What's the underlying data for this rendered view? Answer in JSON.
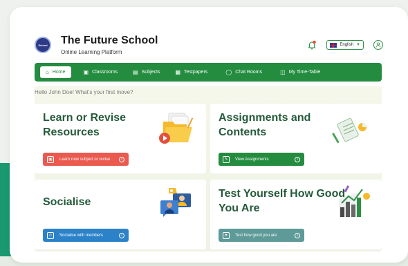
{
  "brand": {
    "logo_text": "School",
    "title": "The Future School",
    "subtitle": "Online Learning Platform"
  },
  "topbar": {
    "language": "English",
    "bell_icon": "bell-icon",
    "avatar_icon": "user-icon"
  },
  "nav": {
    "items": [
      {
        "label": "Home",
        "icon": "home-icon",
        "active": true
      },
      {
        "label": "Classrooms",
        "icon": "book-icon"
      },
      {
        "label": "Subjects",
        "icon": "document-icon"
      },
      {
        "label": "Testpapers",
        "icon": "testpaper-icon"
      },
      {
        "label": "Chat Rooms",
        "icon": "chat-icon"
      },
      {
        "label": "My Time-Table",
        "icon": "calendar-icon"
      }
    ]
  },
  "greeting": "Hello John Doe! What's your first move?",
  "cards": [
    {
      "title_line1": "Learn or Revise",
      "title_line2": "Resources",
      "button": "Learn new subject or revise",
      "color": "#ea5a4f"
    },
    {
      "title_line1": "Assignments and",
      "title_line2": "Contents",
      "button": "View Assignments",
      "color": "#238c3f"
    },
    {
      "title_line1": "Socialise",
      "title_line2": "",
      "button": "Socialise with members",
      "color": "#2b82c9"
    },
    {
      "title_line1": "Test Yourself How Good",
      "title_line2": "You Are",
      "button": "Test how good you are",
      "color": "#5d9a98"
    }
  ],
  "colors": {
    "primary_green": "#238c3f",
    "title_green": "#255a3a",
    "teal_bg": "#1a9970"
  }
}
